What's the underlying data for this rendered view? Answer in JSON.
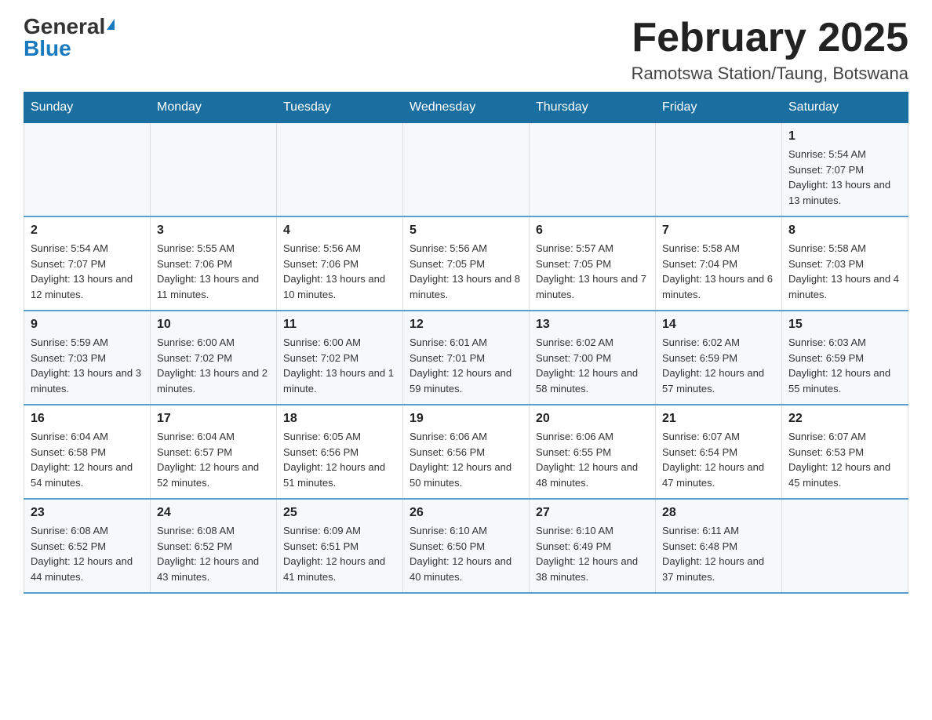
{
  "logo": {
    "general": "General",
    "blue": "Blue"
  },
  "title": "February 2025",
  "location": "Ramotswa Station/Taung, Botswana",
  "days_of_week": [
    "Sunday",
    "Monday",
    "Tuesday",
    "Wednesday",
    "Thursday",
    "Friday",
    "Saturday"
  ],
  "weeks": [
    [
      {
        "day": "",
        "info": ""
      },
      {
        "day": "",
        "info": ""
      },
      {
        "day": "",
        "info": ""
      },
      {
        "day": "",
        "info": ""
      },
      {
        "day": "",
        "info": ""
      },
      {
        "day": "",
        "info": ""
      },
      {
        "day": "1",
        "info": "Sunrise: 5:54 AM\nSunset: 7:07 PM\nDaylight: 13 hours and 13 minutes."
      }
    ],
    [
      {
        "day": "2",
        "info": "Sunrise: 5:54 AM\nSunset: 7:07 PM\nDaylight: 13 hours and 12 minutes."
      },
      {
        "day": "3",
        "info": "Sunrise: 5:55 AM\nSunset: 7:06 PM\nDaylight: 13 hours and 11 minutes."
      },
      {
        "day": "4",
        "info": "Sunrise: 5:56 AM\nSunset: 7:06 PM\nDaylight: 13 hours and 10 minutes."
      },
      {
        "day": "5",
        "info": "Sunrise: 5:56 AM\nSunset: 7:05 PM\nDaylight: 13 hours and 8 minutes."
      },
      {
        "day": "6",
        "info": "Sunrise: 5:57 AM\nSunset: 7:05 PM\nDaylight: 13 hours and 7 minutes."
      },
      {
        "day": "7",
        "info": "Sunrise: 5:58 AM\nSunset: 7:04 PM\nDaylight: 13 hours and 6 minutes."
      },
      {
        "day": "8",
        "info": "Sunrise: 5:58 AM\nSunset: 7:03 PM\nDaylight: 13 hours and 4 minutes."
      }
    ],
    [
      {
        "day": "9",
        "info": "Sunrise: 5:59 AM\nSunset: 7:03 PM\nDaylight: 13 hours and 3 minutes."
      },
      {
        "day": "10",
        "info": "Sunrise: 6:00 AM\nSunset: 7:02 PM\nDaylight: 13 hours and 2 minutes."
      },
      {
        "day": "11",
        "info": "Sunrise: 6:00 AM\nSunset: 7:02 PM\nDaylight: 13 hours and 1 minute."
      },
      {
        "day": "12",
        "info": "Sunrise: 6:01 AM\nSunset: 7:01 PM\nDaylight: 12 hours and 59 minutes."
      },
      {
        "day": "13",
        "info": "Sunrise: 6:02 AM\nSunset: 7:00 PM\nDaylight: 12 hours and 58 minutes."
      },
      {
        "day": "14",
        "info": "Sunrise: 6:02 AM\nSunset: 6:59 PM\nDaylight: 12 hours and 57 minutes."
      },
      {
        "day": "15",
        "info": "Sunrise: 6:03 AM\nSunset: 6:59 PM\nDaylight: 12 hours and 55 minutes."
      }
    ],
    [
      {
        "day": "16",
        "info": "Sunrise: 6:04 AM\nSunset: 6:58 PM\nDaylight: 12 hours and 54 minutes."
      },
      {
        "day": "17",
        "info": "Sunrise: 6:04 AM\nSunset: 6:57 PM\nDaylight: 12 hours and 52 minutes."
      },
      {
        "day": "18",
        "info": "Sunrise: 6:05 AM\nSunset: 6:56 PM\nDaylight: 12 hours and 51 minutes."
      },
      {
        "day": "19",
        "info": "Sunrise: 6:06 AM\nSunset: 6:56 PM\nDaylight: 12 hours and 50 minutes."
      },
      {
        "day": "20",
        "info": "Sunrise: 6:06 AM\nSunset: 6:55 PM\nDaylight: 12 hours and 48 minutes."
      },
      {
        "day": "21",
        "info": "Sunrise: 6:07 AM\nSunset: 6:54 PM\nDaylight: 12 hours and 47 minutes."
      },
      {
        "day": "22",
        "info": "Sunrise: 6:07 AM\nSunset: 6:53 PM\nDaylight: 12 hours and 45 minutes."
      }
    ],
    [
      {
        "day": "23",
        "info": "Sunrise: 6:08 AM\nSunset: 6:52 PM\nDaylight: 12 hours and 44 minutes."
      },
      {
        "day": "24",
        "info": "Sunrise: 6:08 AM\nSunset: 6:52 PM\nDaylight: 12 hours and 43 minutes."
      },
      {
        "day": "25",
        "info": "Sunrise: 6:09 AM\nSunset: 6:51 PM\nDaylight: 12 hours and 41 minutes."
      },
      {
        "day": "26",
        "info": "Sunrise: 6:10 AM\nSunset: 6:50 PM\nDaylight: 12 hours and 40 minutes."
      },
      {
        "day": "27",
        "info": "Sunrise: 6:10 AM\nSunset: 6:49 PM\nDaylight: 12 hours and 38 minutes."
      },
      {
        "day": "28",
        "info": "Sunrise: 6:11 AM\nSunset: 6:48 PM\nDaylight: 12 hours and 37 minutes."
      },
      {
        "day": "",
        "info": ""
      }
    ]
  ]
}
